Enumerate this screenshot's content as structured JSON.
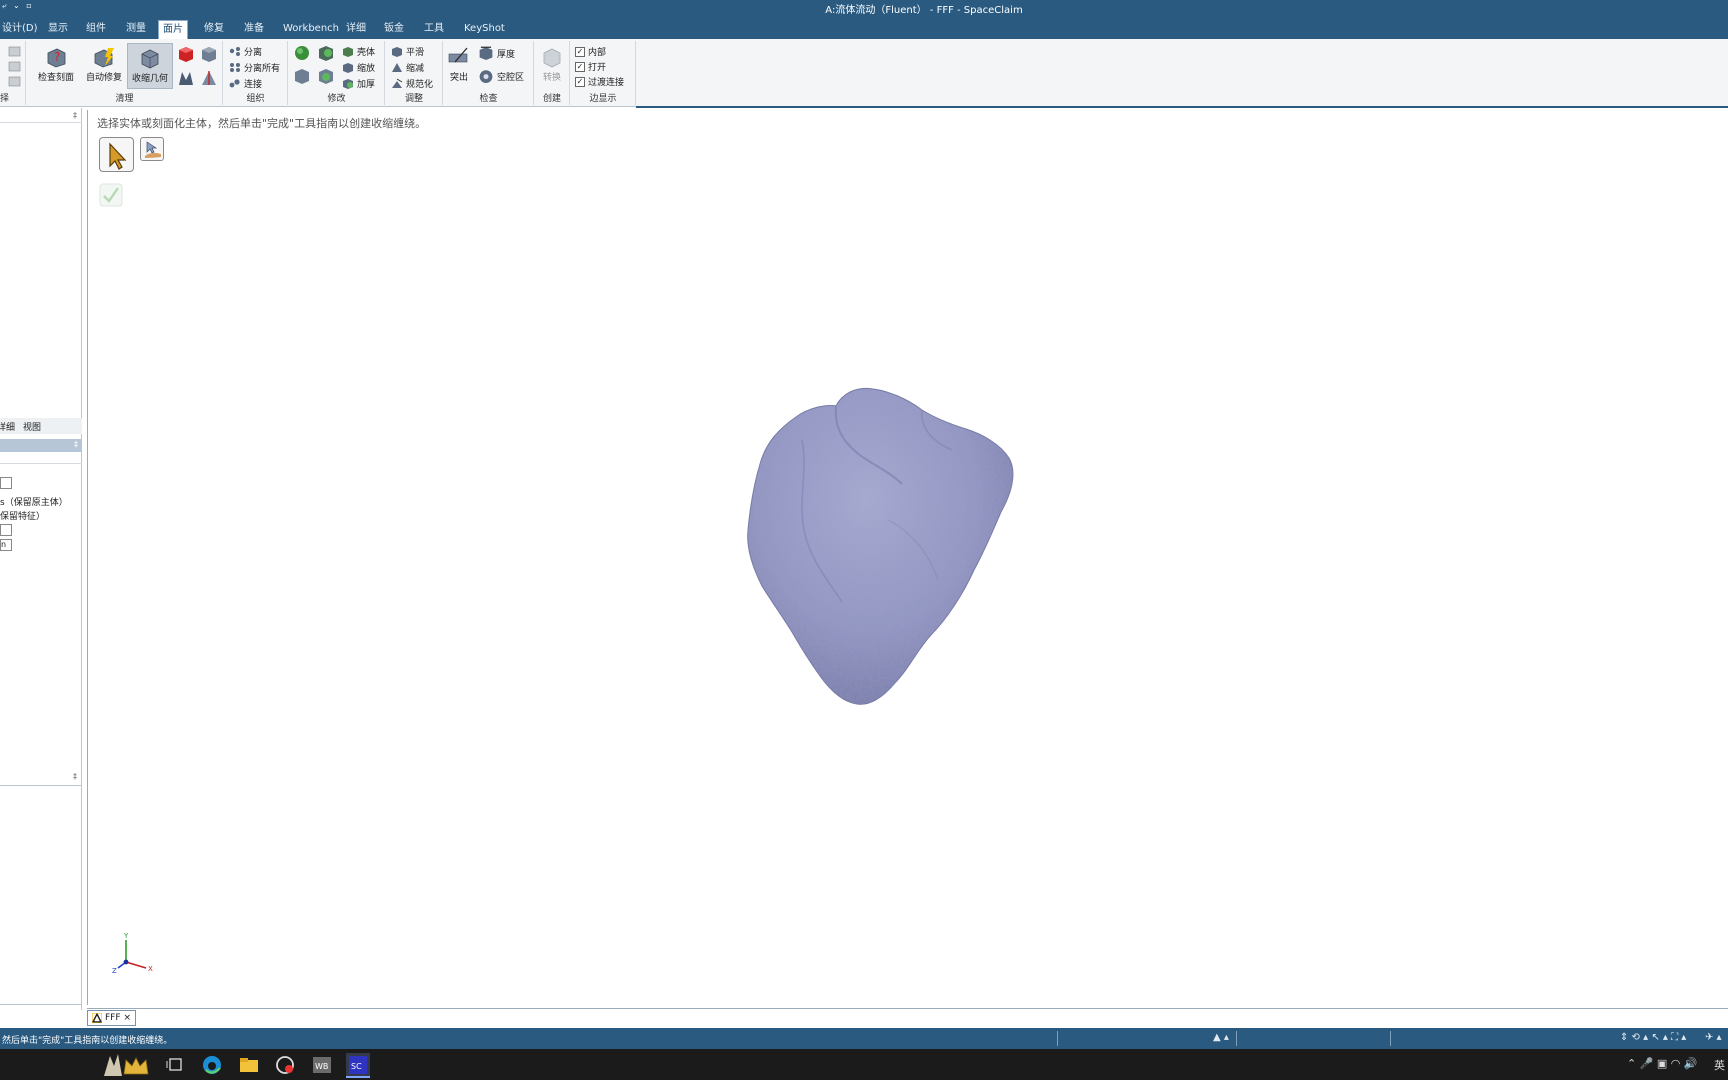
{
  "titlebar": {
    "quick_access": "⤶ ⌄ ▫",
    "title": "A:流体流动（Fluent） - FFF - SpaceClaim"
  },
  "tabs": [
    {
      "label": "设计(D)",
      "active": false
    },
    {
      "label": "显示",
      "active": false
    },
    {
      "label": "组件",
      "active": false
    },
    {
      "label": "测量",
      "active": false
    },
    {
      "label": "面片",
      "active": true
    },
    {
      "label": "修复",
      "active": false
    },
    {
      "label": "准备",
      "active": false
    },
    {
      "label": "Workbench",
      "active": false
    },
    {
      "label": "详细",
      "active": false
    },
    {
      "label": "钣金",
      "active": false
    },
    {
      "label": "工具",
      "active": false
    },
    {
      "label": "KeyShot",
      "active": false
    }
  ],
  "ribbon": {
    "select_group_label": "择",
    "cleanup": {
      "label": "清理",
      "check_facets": "检查刻面",
      "auto_fix": "自动修复",
      "shrinkwrap": "收缩几何"
    },
    "organize": {
      "label": "组织",
      "separate": "分离",
      "separate_all": "分离所有",
      "connect": "连接"
    },
    "modify": {
      "label": "修改",
      "shell": "壳体",
      "shrink": "缩放",
      "thicken": "加厚"
    },
    "adjust": {
      "label": "调整",
      "flatten": "平滑",
      "reduce": "缩减",
      "normalize": "规范化"
    },
    "inspect": {
      "label": "检查",
      "protrude": "突出",
      "thickness": "厚度",
      "cavity": "空腔区"
    },
    "create": {
      "label": "创建",
      "convert": "转换"
    },
    "edge_display": {
      "label": "边显示",
      "interior": "内部",
      "open": "打开",
      "transition": "过渡连接",
      "interior_checked": "✓",
      "open_checked": "✓",
      "transition_checked": "✓"
    }
  },
  "left_panel": {
    "pin": "‡",
    "tabs_label_1": "详细",
    "tabs_label_1_visible": "详细",
    "tabs_label_2": "视图",
    "option_1": "s（保留原主体）",
    "option_2": "保留特征）",
    "field_value": "n"
  },
  "viewport": {
    "hint": "选择实体或刻面化主体，然后单击\"完成\"工具指南以创建收缩缠绕。",
    "axis_x": "X",
    "axis_y": "Y",
    "axis_z": "Z"
  },
  "doc_tab": {
    "label": "FFF",
    "close": "×"
  },
  "statusbar": {
    "message": "然后单击\"完成\"工具指南以创建收缩缠绕。",
    "ime": "英"
  },
  "colors": {
    "titlebar": "#2a5a80",
    "ribbon_bg": "#f3f5f7",
    "rock": "#9195c4",
    "taskbar": "#1b1b1b"
  }
}
